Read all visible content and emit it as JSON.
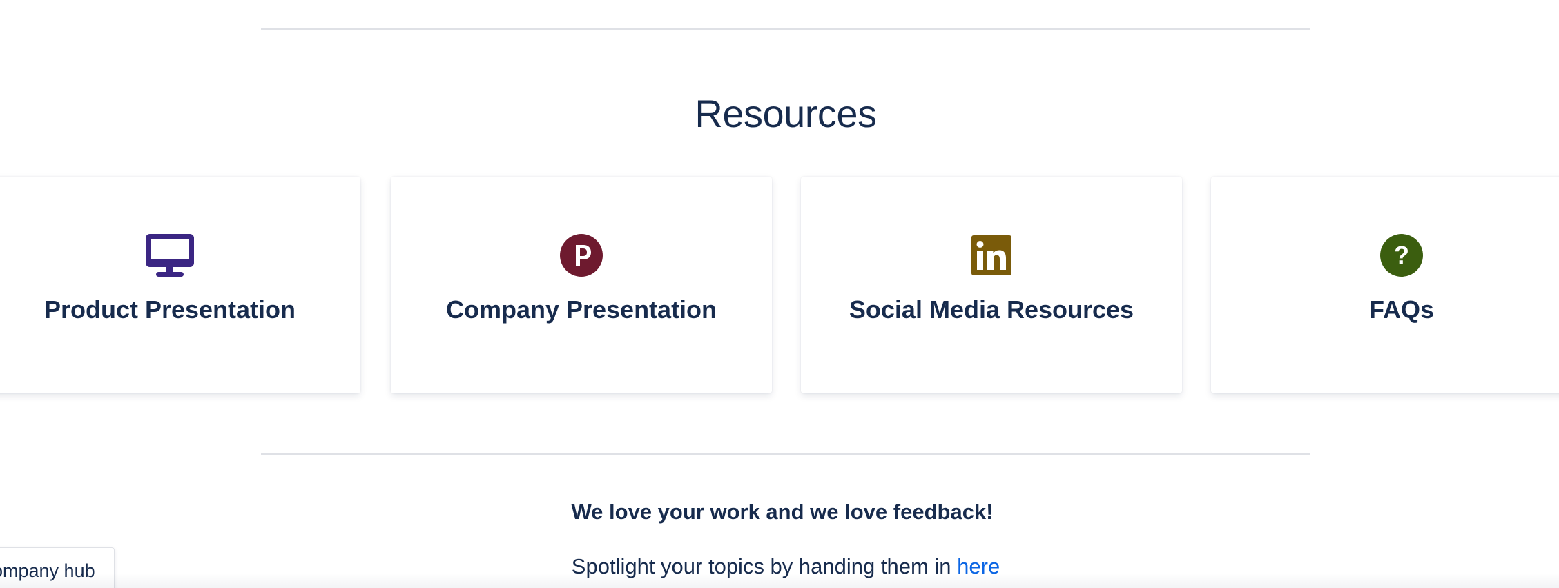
{
  "resources": {
    "title": "Resources",
    "cards": [
      {
        "label": "Product Presentation",
        "icon": "desktop-icon",
        "icon_color": "#3b2683"
      },
      {
        "label": "Company Presentation",
        "icon": "p-circle-icon",
        "icon_color": "#6e1a2f"
      },
      {
        "label": "Social Media Resources",
        "icon": "linkedin-icon",
        "icon_color": "#7a5b0a"
      },
      {
        "label": "FAQs",
        "icon": "question-circle-icon",
        "icon_color": "#3b5e0f"
      }
    ]
  },
  "feedback": {
    "heading": "We love your work and we love feedback!",
    "text": "Spotlight your topics by handing them in",
    "link": "here"
  },
  "hub_tab": {
    "label": "ompany hub"
  },
  "colors": {
    "text": "#172b4d",
    "link": "#0c66e4",
    "divider": "#dfe1e6"
  }
}
